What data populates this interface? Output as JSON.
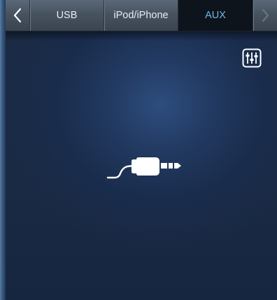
{
  "source_tabs": {
    "back_icon": "chevron-left-icon",
    "forward_icon": "chevron-right-icon",
    "items": [
      {
        "label": "USB",
        "active": false
      },
      {
        "label": "iPod/iPhone",
        "active": false
      },
      {
        "label": "AUX",
        "active": true
      }
    ]
  },
  "main": {
    "settings_icon": "equalizer-sliders-icon",
    "status_icon": "aux-cable-icon"
  },
  "colors": {
    "active_tab_text": "#6fb7ea",
    "active_tab_bg": "#0e141b",
    "background": "#1b2b45",
    "icon": "#ffffff"
  }
}
